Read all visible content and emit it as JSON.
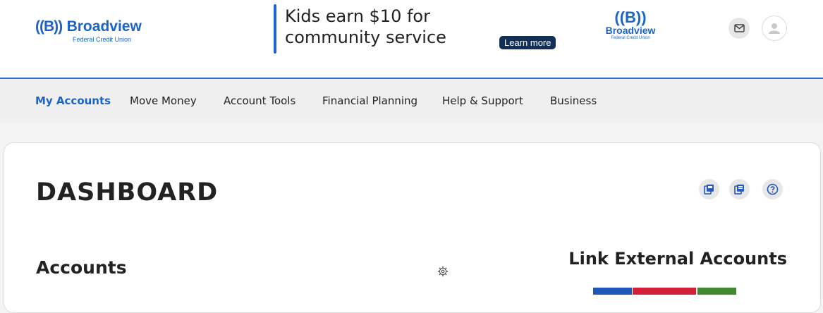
{
  "header": {
    "logo_mark": "((B))",
    "logo_brand": "Broadview",
    "logo_sub": "Federal Credit Union",
    "ad_headline": "Kids earn $10 for community service",
    "ad_button": "Learn more",
    "ad_logo_mark": "((B))",
    "ad_logo_brand": "Broadview",
    "ad_logo_sub": "Federal Credit Union",
    "mail_icon": "mail-icon",
    "avatar_icon": "user-icon"
  },
  "nav": {
    "items": [
      {
        "label": "My Accounts",
        "active": true
      },
      {
        "label": "Move Money"
      },
      {
        "label": "Account Tools"
      },
      {
        "label": "Financial Planning"
      },
      {
        "label": "Help & Support"
      },
      {
        "label": "Business"
      }
    ]
  },
  "dashboard": {
    "title": "DASHBOARD",
    "tools": [
      "print-icon",
      "document-icon",
      "help-icon"
    ],
    "accounts_heading": "Accounts",
    "settings_icon": "gear-icon",
    "link_heading": "Link External Accounts"
  },
  "colors": {
    "brand": "#1a64c8",
    "ad_button": "#10305a",
    "active_nav": "#1a64c8",
    "strip_blue": "#1f57b8",
    "strip_red": "#d1203a",
    "strip_green": "#3f8a2e"
  }
}
